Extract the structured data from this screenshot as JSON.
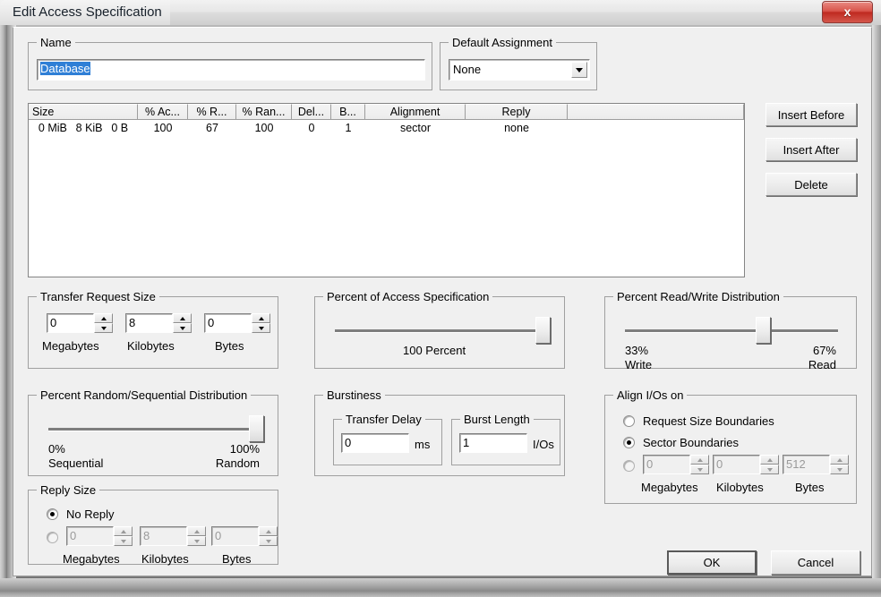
{
  "window": {
    "title": "Edit Access Specification",
    "close_label": "x"
  },
  "name_group": {
    "title": "Name",
    "value": "Database"
  },
  "default_assignment": {
    "title": "Default Assignment",
    "value": "None",
    "options": [
      "None"
    ]
  },
  "table": {
    "columns": [
      "Size",
      "% Ac...",
      "% R...",
      "% Ran...",
      "Del...",
      "B...",
      "Alignment",
      "Reply",
      ""
    ],
    "rows": [
      {
        "size_mib": "0 MiB",
        "size_kib": "8 KiB",
        "size_b": "0 B",
        "percent_access": "100",
        "percent_read": "67",
        "percent_random": "100",
        "delay": "0",
        "burst": "1",
        "alignment": "sector",
        "reply": "none"
      }
    ]
  },
  "side_buttons": {
    "insert_before": "Insert Before",
    "insert_after": "Insert After",
    "delete": "Delete"
  },
  "transfer_request_size": {
    "title": "Transfer Request Size",
    "megabytes": {
      "value": "0",
      "label": "Megabytes"
    },
    "kilobytes": {
      "value": "8",
      "label": "Kilobytes"
    },
    "bytes": {
      "value": "0",
      "label": "Bytes"
    }
  },
  "percent_access_spec": {
    "title": "Percent of Access Specification",
    "value_label": "100 Percent",
    "slider_percent": 100
  },
  "read_write_distribution": {
    "title": "Percent Read/Write Distribution",
    "left_percent": "33%",
    "left_label": "Write",
    "right_percent": "67%",
    "right_label": "Read",
    "slider_percent": 63
  },
  "random_sequential_distribution": {
    "title": "Percent Random/Sequential Distribution",
    "left_percent": "0%",
    "left_label": "Sequential",
    "right_percent": "100%",
    "right_label": "Random",
    "slider_percent": 100
  },
  "burstiness": {
    "title": "Burstiness",
    "transfer_delay": {
      "title": "Transfer Delay",
      "value": "0",
      "unit": "ms"
    },
    "burst_length": {
      "title": "Burst Length",
      "value": "1",
      "unit": "I/Os"
    }
  },
  "align_ios": {
    "title": "Align I/Os on",
    "option_request_size": "Request Size Boundaries",
    "option_sector": "Sector Boundaries",
    "selected": "sector",
    "megabytes": {
      "value": "0",
      "label": "Megabytes"
    },
    "kilobytes": {
      "value": "0",
      "label": "Kilobytes"
    },
    "bytes": {
      "value": "512",
      "label": "Bytes"
    }
  },
  "reply_size": {
    "title": "Reply Size",
    "option_no_reply": "No Reply",
    "selected": "no_reply",
    "megabytes": {
      "value": "0",
      "label": "Megabytes"
    },
    "kilobytes": {
      "value": "8",
      "label": "Kilobytes"
    },
    "bytes": {
      "value": "0",
      "label": "Bytes"
    }
  },
  "footer": {
    "ok": "OK",
    "cancel": "Cancel"
  },
  "colors": {
    "selection": "#2f7fd6",
    "close_button": "#bf2a20",
    "dialog_face": "#f0f0f0"
  }
}
